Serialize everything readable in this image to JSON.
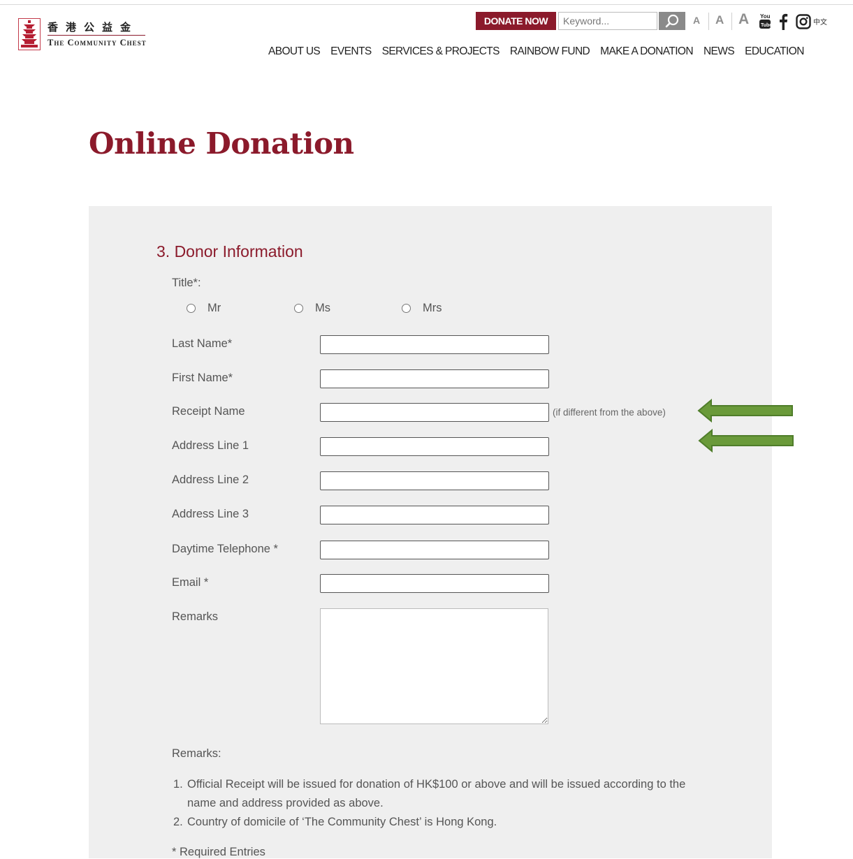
{
  "header": {
    "logo_cn": "香港公益金",
    "logo_en": "The Community Chest",
    "donate_now": "DONATE NOW",
    "search_placeholder": "Keyword...",
    "font_sizes": [
      "A",
      "A",
      "A"
    ],
    "lang_label": "中文",
    "social_icons": [
      "youtube-icon",
      "facebook-icon",
      "instagram-icon"
    ]
  },
  "nav": [
    "ABOUT US",
    "EVENTS",
    "SERVICES & PROJECTS",
    "RAINBOW FUND",
    "MAKE A DONATION",
    "NEWS",
    "EDUCATION"
  ],
  "page_title": "Online Donation",
  "form": {
    "section_title": "3. Donor Information",
    "title_label": "Title*:",
    "title_options": [
      "Mr",
      "Ms",
      "Mrs"
    ],
    "fields": [
      {
        "label": "Last Name*",
        "value": ""
      },
      {
        "label": "First Name*",
        "value": ""
      },
      {
        "label": "Receipt Name",
        "value": ""
      },
      {
        "label": "Address Line 1",
        "value": ""
      },
      {
        "label": "Address Line 2",
        "value": ""
      },
      {
        "label": "Address Line 3",
        "value": ""
      },
      {
        "label": "Daytime Telephone *",
        "value": ""
      },
      {
        "label": "Email *",
        "value": ""
      }
    ],
    "receipt_hint": "(if different from the above)",
    "remarks_label": "Remarks",
    "remarks_value": "",
    "notes_heading": "Remarks:",
    "notes": [
      {
        "num": "1.",
        "text": "Official Receipt will be issued for donation of HK$100 or above and will be issued according to the name and address provided as above."
      },
      {
        "num": "2.",
        "text": "Country of domicile of ‘The Community Chest’ is Hong Kong."
      }
    ],
    "required_note": "* Required Entries"
  },
  "colors": {
    "brand": "#8b1a2b",
    "panel": "#efefef",
    "arrow": "#6a9a3a"
  }
}
